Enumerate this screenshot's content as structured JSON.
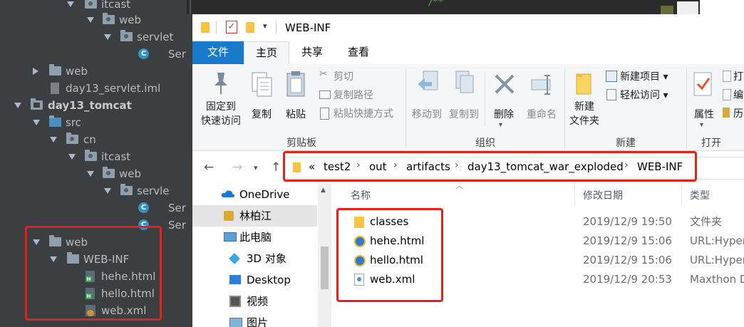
{
  "ide": {
    "rows": [
      {
        "label": "itcast",
        "type": "pkg"
      },
      {
        "label": "web",
        "type": "pkg"
      },
      {
        "label": "servlet",
        "type": "pkg"
      },
      {
        "label": "Ser",
        "type": "class"
      },
      {
        "label": "web",
        "type": "folder"
      },
      {
        "label": "day13_servlet.iml",
        "type": "iml"
      },
      {
        "label": "day13_tomcat",
        "type": "module"
      },
      {
        "label": "src",
        "type": "folder"
      },
      {
        "label": "cn",
        "type": "pkg"
      },
      {
        "label": "itcast",
        "type": "pkg"
      },
      {
        "label": "web",
        "type": "pkg"
      },
      {
        "label": "servle",
        "type": "pkg"
      },
      {
        "label": "Ser",
        "type": "class"
      },
      {
        "label": "Ser",
        "type": "class"
      },
      {
        "label": "web",
        "type": "folder"
      },
      {
        "label": "WEB-INF",
        "type": "folder"
      },
      {
        "label": "hehe.html",
        "type": "html"
      },
      {
        "label": "hello.html",
        "type": "html"
      },
      {
        "label": "web.xml",
        "type": "xml"
      }
    ],
    "code_comment": "/**"
  },
  "explorer": {
    "title": "WEB-INF",
    "tabs": {
      "file": "文件",
      "home": "主页",
      "share": "共享",
      "view": "查看"
    },
    "ribbon": {
      "pin": "固定到\n快速访问",
      "copy": "复制",
      "paste": "粘贴",
      "cut": "剪切",
      "copy_path": "复制路径",
      "paste_shortcut": "粘贴快捷方式",
      "move_to": "移动到",
      "copy_to": "复制到",
      "delete": "删除",
      "rename": "重命名",
      "new_folder": "新建\n文件夹",
      "new_item": "新建项目 ▾",
      "easy_access": "轻松访问 ▾",
      "properties": "属性",
      "open_small_1": "打",
      "open_small_2": "编",
      "open_small_3": "历",
      "group_clipboard": "剪贴板",
      "group_organize": "组织",
      "group_new": "新建",
      "group_open": "打开"
    },
    "breadcrumb": {
      "overflow": "«",
      "parts": [
        "test2",
        "out",
        "artifacts",
        "day13_tomcat_war_exploded",
        "WEB-INF"
      ]
    },
    "nav_pane": [
      {
        "label": "OneDrive",
        "icon": "cloud-icon"
      },
      {
        "label": "林柏江",
        "icon": "user-folder-icon"
      },
      {
        "label": "此电脑",
        "icon": "computer-icon"
      },
      {
        "label": "3D 对象",
        "icon": "3d-objects-icon"
      },
      {
        "label": "Desktop",
        "icon": "desktop-icon"
      },
      {
        "label": "视频",
        "icon": "video-icon"
      },
      {
        "label": "图片",
        "icon": "pictures-icon"
      }
    ],
    "columns": {
      "name": "名称",
      "date": "修改日期",
      "type": "类型"
    },
    "files": [
      {
        "name": "classes",
        "date": "2019/12/9 19:50",
        "type": "文件夹",
        "icon": "folder-icon"
      },
      {
        "name": "hehe.html",
        "date": "2019/12/9 15:06",
        "type": "URL:Hyper",
        "icon": "ie-html-icon"
      },
      {
        "name": "hello.html",
        "date": "2019/12/9 15:06",
        "type": "URL:Hyper",
        "icon": "ie-html-icon"
      },
      {
        "name": "web.xml",
        "date": "2019/12/9 20:53",
        "type": "Maxthon D",
        "icon": "xml-file-icon"
      }
    ]
  },
  "colors": {
    "ide_bg": "#3c3f41",
    "ribbon_file_tab": "#1979ca",
    "highlight_red": "#e8201c",
    "selected_nav": "#e5e5e5"
  }
}
